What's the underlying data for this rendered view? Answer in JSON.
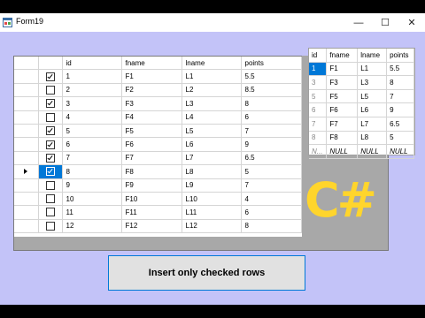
{
  "window": {
    "title": "Form19"
  },
  "titlebar": {
    "minimize": "—",
    "maximize": "☐",
    "close": "✕"
  },
  "grid1": {
    "columns": [
      "id",
      "fname",
      "lname",
      "points"
    ],
    "current_row_index": 7,
    "rows": [
      {
        "checked": true,
        "id": "1",
        "fname": "F1",
        "lname": "L1",
        "points": "5.5"
      },
      {
        "checked": false,
        "id": "2",
        "fname": "F2",
        "lname": "L2",
        "points": "8.5"
      },
      {
        "checked": true,
        "id": "3",
        "fname": "F3",
        "lname": "L3",
        "points": "8"
      },
      {
        "checked": false,
        "id": "4",
        "fname": "F4",
        "lname": "L4",
        "points": "6"
      },
      {
        "checked": true,
        "id": "5",
        "fname": "F5",
        "lname": "L5",
        "points": "7"
      },
      {
        "checked": true,
        "id": "6",
        "fname": "F6",
        "lname": "L6",
        "points": "9"
      },
      {
        "checked": true,
        "id": "7",
        "fname": "F7",
        "lname": "L7",
        "points": "6.5"
      },
      {
        "checked": true,
        "id": "8",
        "fname": "F8",
        "lname": "L8",
        "points": "5"
      },
      {
        "checked": false,
        "id": "9",
        "fname": "F9",
        "lname": "L9",
        "points": "7"
      },
      {
        "checked": false,
        "id": "10",
        "fname": "F10",
        "lname": "L10",
        "points": "4"
      },
      {
        "checked": false,
        "id": "11",
        "fname": "F11",
        "lname": "L11",
        "points": "6"
      },
      {
        "checked": false,
        "id": "12",
        "fname": "F12",
        "lname": "L12",
        "points": "8"
      }
    ]
  },
  "grid2": {
    "columns": [
      "id",
      "fname",
      "lname",
      "points"
    ],
    "rows": [
      {
        "id": "1",
        "fname": "F1",
        "lname": "L1",
        "points": "5.5"
      },
      {
        "id": "3",
        "fname": "F3",
        "lname": "L3",
        "points": "8"
      },
      {
        "id": "5",
        "fname": "F5",
        "lname": "L5",
        "points": "7"
      },
      {
        "id": "6",
        "fname": "F6",
        "lname": "L6",
        "points": "9"
      },
      {
        "id": "7",
        "fname": "F7",
        "lname": "L7",
        "points": "6.5"
      },
      {
        "id": "8",
        "fname": "F8",
        "lname": "L8",
        "points": "5"
      }
    ],
    "new_row": {
      "id": "N...",
      "fname": "NULL",
      "lname": "NULL",
      "points": "NULL"
    }
  },
  "logo_text": "C#",
  "insert_button": {
    "label": "Insert only checked rows"
  },
  "colors": {
    "form_background": "#C3C3F8",
    "selection": "#0078D7",
    "logo": "#FFD52C",
    "grid_empty": "#A8A8A8"
  }
}
